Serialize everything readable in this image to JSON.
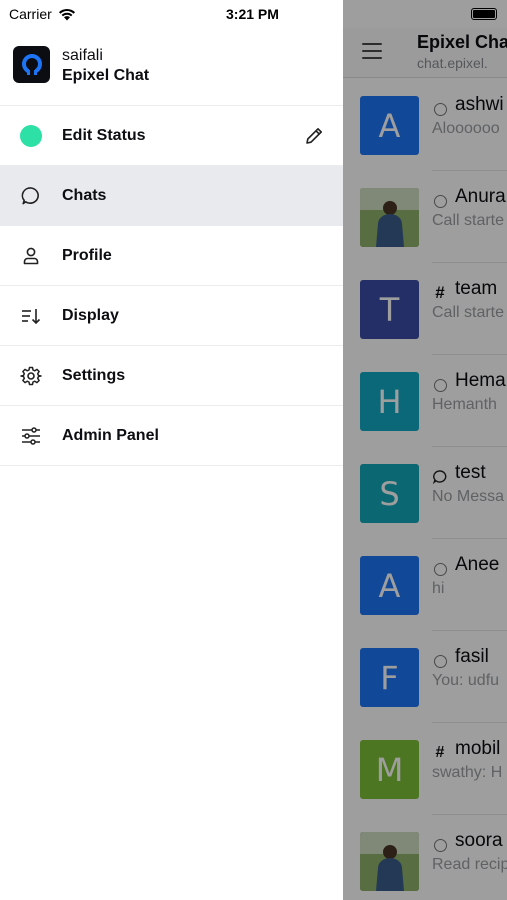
{
  "status_bar": {
    "carrier": "Carrier",
    "time": "3:21 PM"
  },
  "account": {
    "username": "saifali",
    "server_name": "Epixel Chat"
  },
  "menu": [
    {
      "id": "edit-status",
      "label": "Edit Status",
      "icon": "status-dot",
      "status_color": "#2de0a5"
    },
    {
      "id": "chats",
      "label": "Chats",
      "icon": "chat-bubble-icon",
      "active": true
    },
    {
      "id": "profile",
      "label": "Profile",
      "icon": "user-icon"
    },
    {
      "id": "display",
      "label": "Display",
      "icon": "sort-icon"
    },
    {
      "id": "settings",
      "label": "Settings",
      "icon": "gear-icon"
    },
    {
      "id": "admin-panel",
      "label": "Admin Panel",
      "icon": "sliders-icon"
    }
  ],
  "chat_list": {
    "title": "Epixel Cha",
    "subtitle": "chat.epixel.",
    "rooms": [
      {
        "type": "ring",
        "name": "ashwi",
        "message": "Aloooooo",
        "avatar_letter": "A",
        "avatar_color": "#1d74f5"
      },
      {
        "type": "ring",
        "name": "Anura",
        "message": "Call starte",
        "avatar_letter": "",
        "avatar_color": "#6e8f3a",
        "photo": true
      },
      {
        "type": "hash",
        "name": "team",
        "message": "Call starte",
        "avatar_letter": "T",
        "avatar_color": "#3b4ca6"
      },
      {
        "type": "ring",
        "name": "Hema",
        "message": "Hemanth",
        "avatar_letter": "H",
        "avatar_color": "#12a8c4"
      },
      {
        "type": "discussion",
        "name": "test",
        "message": "No Messa",
        "avatar_letter": "S",
        "avatar_color": "#13a7b7"
      },
      {
        "type": "ring",
        "name": "Anee",
        "message": "hi",
        "avatar_letter": "A",
        "avatar_color": "#1d74f5"
      },
      {
        "type": "ring",
        "name": "fasil",
        "message": "You: udfu",
        "avatar_letter": "F",
        "avatar_color": "#1d74f5"
      },
      {
        "type": "hash-lock",
        "name": "mobil",
        "message": "swathy: H",
        "avatar_letter": "M",
        "avatar_color": "#7dbe38"
      },
      {
        "type": "ring",
        "name": "soora",
        "message": "Read recip",
        "avatar_letter": "",
        "avatar_color": "#5c7a4b",
        "photo": true
      }
    ]
  }
}
